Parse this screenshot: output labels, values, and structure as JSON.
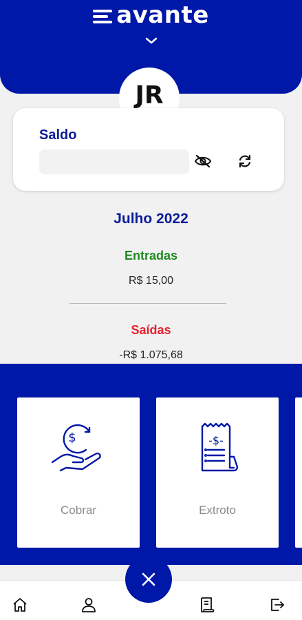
{
  "header": {
    "logo_text": "avante",
    "background_color": "#0018a8",
    "chevron_icon": "chevron-down-icon"
  },
  "profile": {
    "initials": "JR"
  },
  "balance_card": {
    "label": "Saldo",
    "value_hidden": true,
    "eye_icon": "eye-slash-icon",
    "refresh_icon": "refresh-icon"
  },
  "summary": {
    "month": "Julho 2022",
    "entradas_label": "Entradas",
    "entradas_value": "R$ 15,00",
    "entradas_color": "#1e8a1e",
    "saidas_label": "Saídas",
    "saidas_value": "-R$ 1.075,68",
    "saidas_color": "#e8212d"
  },
  "actions": [
    {
      "label": "Cobrar",
      "icon": "hand-coin-icon"
    },
    {
      "label": "Extroto",
      "icon": "receipt-icon"
    }
  ],
  "fab": {
    "icon": "close-icon"
  },
  "bottom_nav": [
    {
      "icon": "home-icon"
    },
    {
      "icon": "user-icon"
    },
    {
      "icon": "document-icon"
    },
    {
      "icon": "logout-icon"
    }
  ]
}
